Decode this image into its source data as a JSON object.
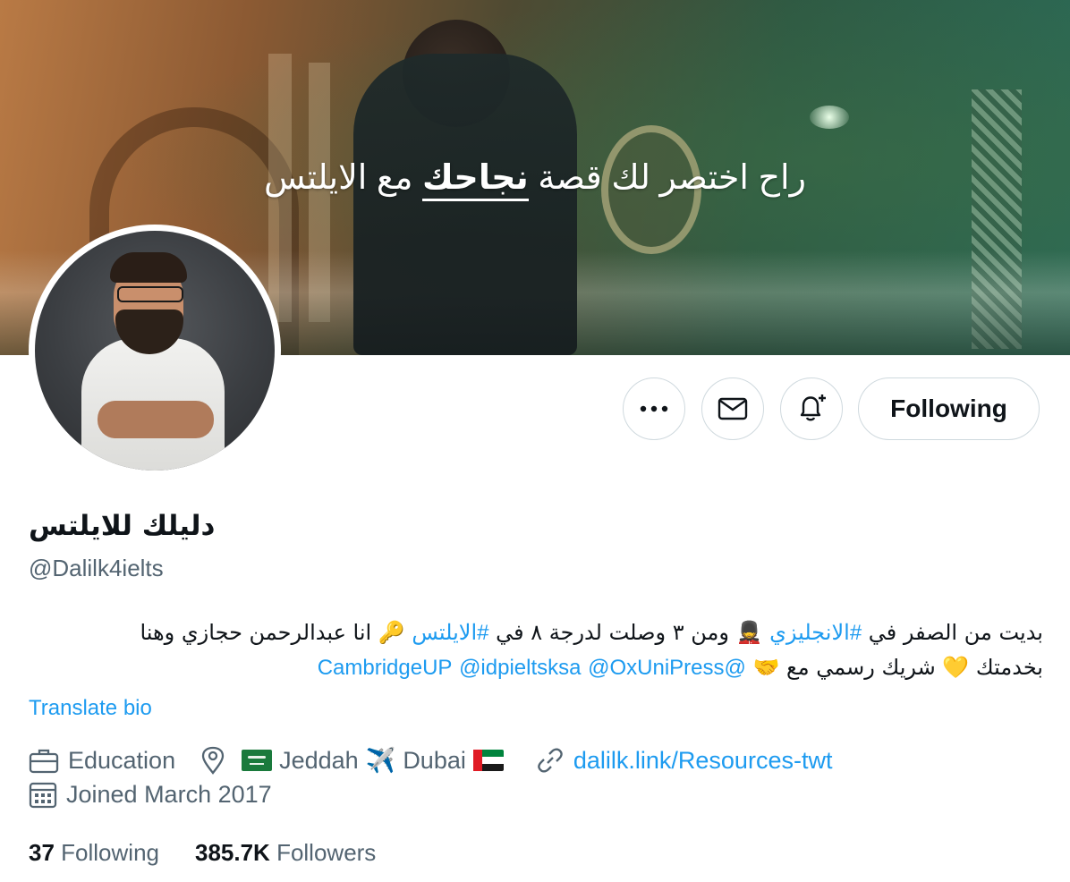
{
  "banner": {
    "tagline_prefix": "راح اختصر لك قصة ",
    "tagline_emphasis": "نجاحك",
    "tagline_suffix": " مع الايلتس"
  },
  "profile": {
    "display_name": "دليلك للايلتس",
    "handle": "@Dalilk4ielts",
    "bio_line1_a": "بديت من الصفر في ",
    "bio_hashtag1": "#الانجليزي",
    "bio_line1_b": " 💂 ومن ٣ وصلت لدرجة ٨ في ",
    "bio_hashtag2": "#الايلتس",
    "bio_line1_c": " 🔑 انا عبدالرحمن حجازي وهنا",
    "bio_line2_a": "بخدمتك 💛 شريك رسمي مع 🤝 ",
    "bio_mention1": "@CambridgeUP",
    "bio_mention2": "@idpieltsksa",
    "bio_mention3": "@OxUniPress",
    "translate_label": "Translate bio"
  },
  "meta": {
    "category": "Education",
    "location_a": "Jeddah",
    "location_b": "Dubai",
    "location_sep": "✈️",
    "website": "dalilk.link/Resources-twt",
    "joined": "Joined March 2017"
  },
  "stats": {
    "following_count": "37",
    "following_label": "Following",
    "followers_count": "385.7K",
    "followers_label": "Followers"
  },
  "actions": {
    "following_button": "Following"
  },
  "colors": {
    "accent": "#1d9bf0",
    "secondary_text": "#536471",
    "border": "#cfd9de"
  }
}
